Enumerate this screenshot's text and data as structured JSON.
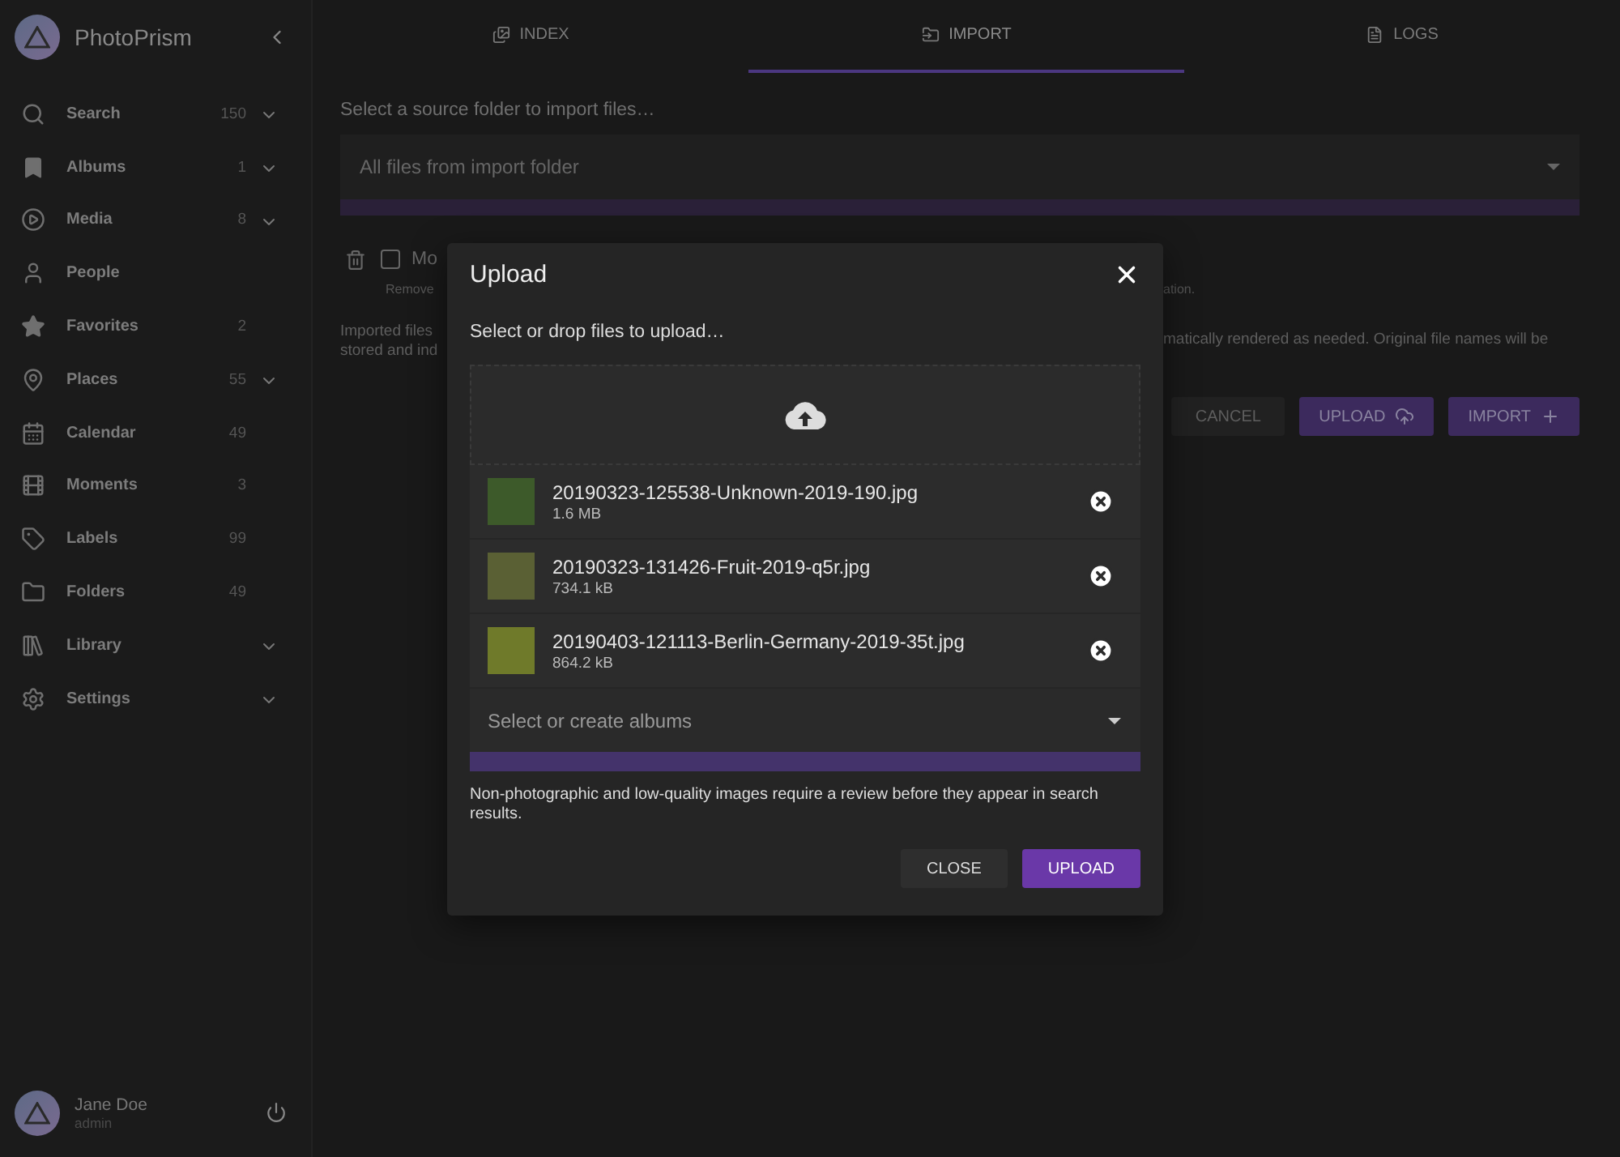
{
  "sidebar": {
    "brand": "PhotoPrism",
    "items": [
      {
        "label": "Search",
        "count": "150",
        "expandable": true
      },
      {
        "label": "Albums",
        "count": "1",
        "expandable": true
      },
      {
        "label": "Media",
        "count": "8",
        "expandable": true
      },
      {
        "label": "People",
        "expandable": false
      },
      {
        "label": "Favorites",
        "count": "2",
        "expandable": false
      },
      {
        "label": "Places",
        "count": "55",
        "expandable": true
      },
      {
        "label": "Calendar",
        "count": "49",
        "expandable": false
      },
      {
        "label": "Moments",
        "count": "3",
        "expandable": false
      },
      {
        "label": "Labels",
        "count": "99",
        "expandable": false
      },
      {
        "label": "Folders",
        "count": "49",
        "expandable": false
      },
      {
        "label": "Library",
        "expandable": true
      },
      {
        "label": "Settings",
        "expandable": true
      }
    ],
    "user": {
      "name": "Jane Doe",
      "role": "admin"
    }
  },
  "tabs": [
    {
      "label": "INDEX",
      "selected": false
    },
    {
      "label": "IMPORT",
      "selected": true
    },
    {
      "label": "LOGS",
      "selected": false
    }
  ],
  "import": {
    "source_label": "Select a source folder to import files…",
    "source_value": "All files from import folder",
    "move_checkbox": {
      "label": "Mo",
      "checked": false
    },
    "hint_left": "Remove",
    "hint_right": "ation.",
    "info_left": [
      "Imported files",
      "stored and ind"
    ],
    "info_right": "matically rendered as needed. Original file names will be",
    "buttons": [
      {
        "label": "CANCEL",
        "disabled": true
      },
      {
        "label": "UPLOAD",
        "disabled": false
      },
      {
        "label": "IMPORT",
        "disabled": false
      }
    ]
  },
  "dialog": {
    "title": "Upload",
    "subtitle": "Select or drop files to upload…",
    "files": [
      {
        "name": "20190323-125538-Unknown-2019-190.jpg",
        "size": "1.6 MB"
      },
      {
        "name": "20190323-131426-Fruit-2019-q5r.jpg",
        "size": "734.1 kB"
      },
      {
        "name": "20190403-121113-Berlin-Germany-2019-35t.jpg",
        "size": "864.2 kB"
      }
    ],
    "albums_placeholder": "Select or create albums",
    "note": "Non-photographic and low-quality images require a review before they appear in search results.",
    "buttons": [
      {
        "label": "CLOSE",
        "primary": false
      },
      {
        "label": "UPLOAD",
        "primary": true
      }
    ]
  }
}
